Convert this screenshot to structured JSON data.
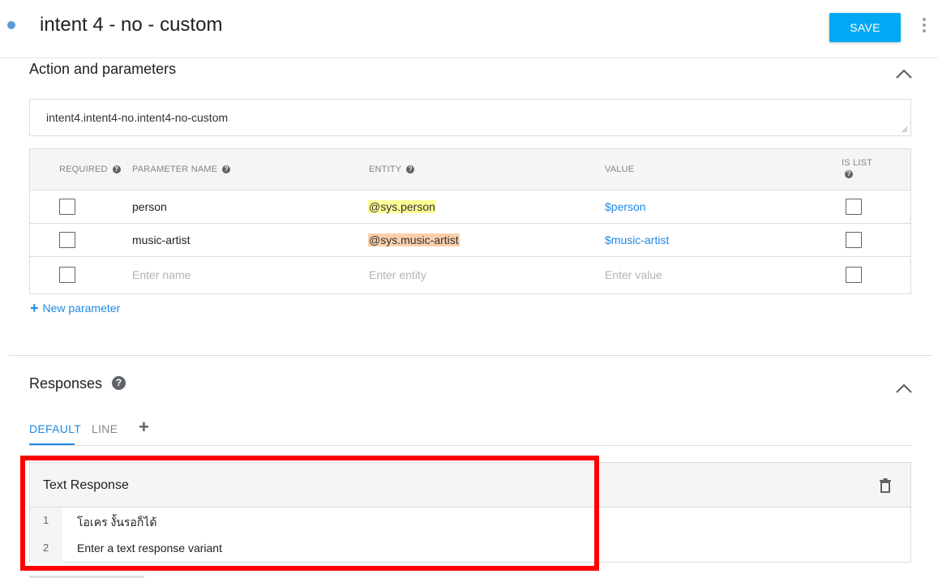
{
  "header": {
    "title": "intent 4 - no - custom",
    "save_label": "SAVE"
  },
  "action_section": {
    "title": "Action and parameters",
    "action_value": "intent4.intent4-no.intent4-no-custom"
  },
  "param_table": {
    "columns": {
      "required": "REQUIRED",
      "name": "PARAMETER NAME",
      "entity": "ENTITY",
      "value": "VALUE",
      "is_list": "IS LIST"
    },
    "rows": [
      {
        "name": "person",
        "entity": "@sys.person",
        "value": "$person"
      },
      {
        "name": "music-artist",
        "entity": "@sys.music-artist",
        "value": "$music-artist"
      }
    ],
    "placeholders": {
      "name": "Enter name",
      "entity": "Enter entity",
      "value": "Enter value"
    },
    "new_parameter_label": "New parameter"
  },
  "responses_section": {
    "title": "Responses",
    "tabs": [
      {
        "label": "DEFAULT",
        "active": true
      },
      {
        "label": "LINE",
        "active": false
      }
    ],
    "text_response": {
      "title": "Text Response",
      "lines": [
        {
          "num": "1",
          "text": "โอเคร งั้นรอก็ได้"
        },
        {
          "num": "2",
          "placeholder": "Enter a text response variant"
        }
      ]
    }
  },
  "colors": {
    "accent": "#03a9f4",
    "link": "#1e88e5",
    "entity_person_bg": "#fdff96",
    "entity_artist_bg": "#fbcfaa",
    "highlight": "#ff0000"
  },
  "icons": [
    "status-dot",
    "more-vert-icon",
    "chevron-up-icon",
    "help-icon",
    "plus-icon",
    "trash-icon"
  ]
}
